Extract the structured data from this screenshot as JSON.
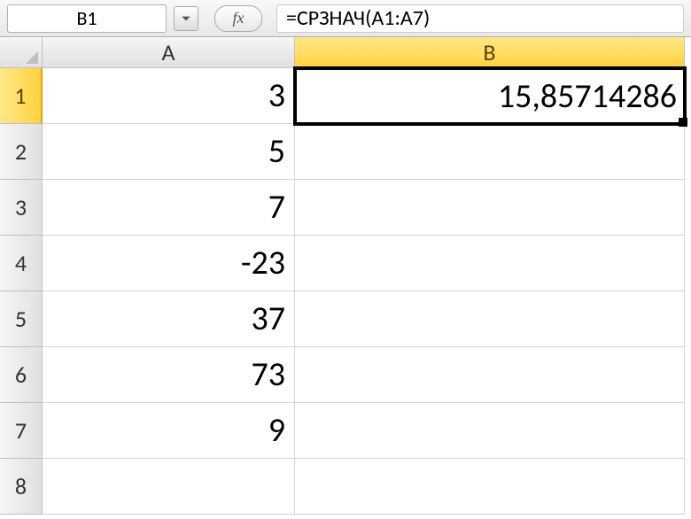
{
  "formula_bar": {
    "cell_ref": "B1",
    "fx_label": "fx",
    "formula": "=СРЗНАЧ(A1:A7)"
  },
  "columns": [
    {
      "label": "A",
      "active": false
    },
    {
      "label": "B",
      "active": true
    }
  ],
  "rows": [
    {
      "label": "1",
      "active": true,
      "A": "3",
      "B": "15,85714286"
    },
    {
      "label": "2",
      "active": false,
      "A": "5",
      "B": ""
    },
    {
      "label": "3",
      "active": false,
      "A": "7",
      "B": ""
    },
    {
      "label": "4",
      "active": false,
      "A": "-23",
      "B": ""
    },
    {
      "label": "5",
      "active": false,
      "A": "37",
      "B": ""
    },
    {
      "label": "6",
      "active": false,
      "A": "73",
      "B": ""
    },
    {
      "label": "7",
      "active": false,
      "A": "9",
      "B": ""
    },
    {
      "label": "8",
      "active": false,
      "A": "",
      "B": ""
    }
  ],
  "selected_cell": "B1"
}
